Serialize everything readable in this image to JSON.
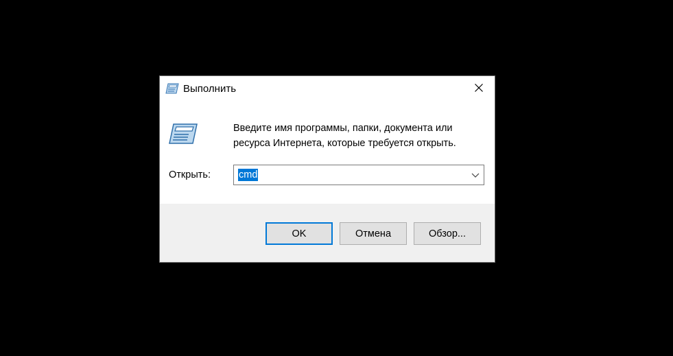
{
  "dialog": {
    "title": "Выполнить",
    "description": "Введите имя программы, папки, документа или ресурса Интернета, которые требуется открыть.",
    "open_label": "Открыть:",
    "command_value": "cmd",
    "icons": {
      "title": "run-icon",
      "main": "run-icon",
      "close": "close-icon",
      "dropdown": "chevron-down-icon"
    },
    "buttons": {
      "ok": "OK",
      "cancel": "Отмена",
      "browse": "Обзор..."
    },
    "colors": {
      "accent": "#0078d7",
      "background": "#000000"
    }
  }
}
